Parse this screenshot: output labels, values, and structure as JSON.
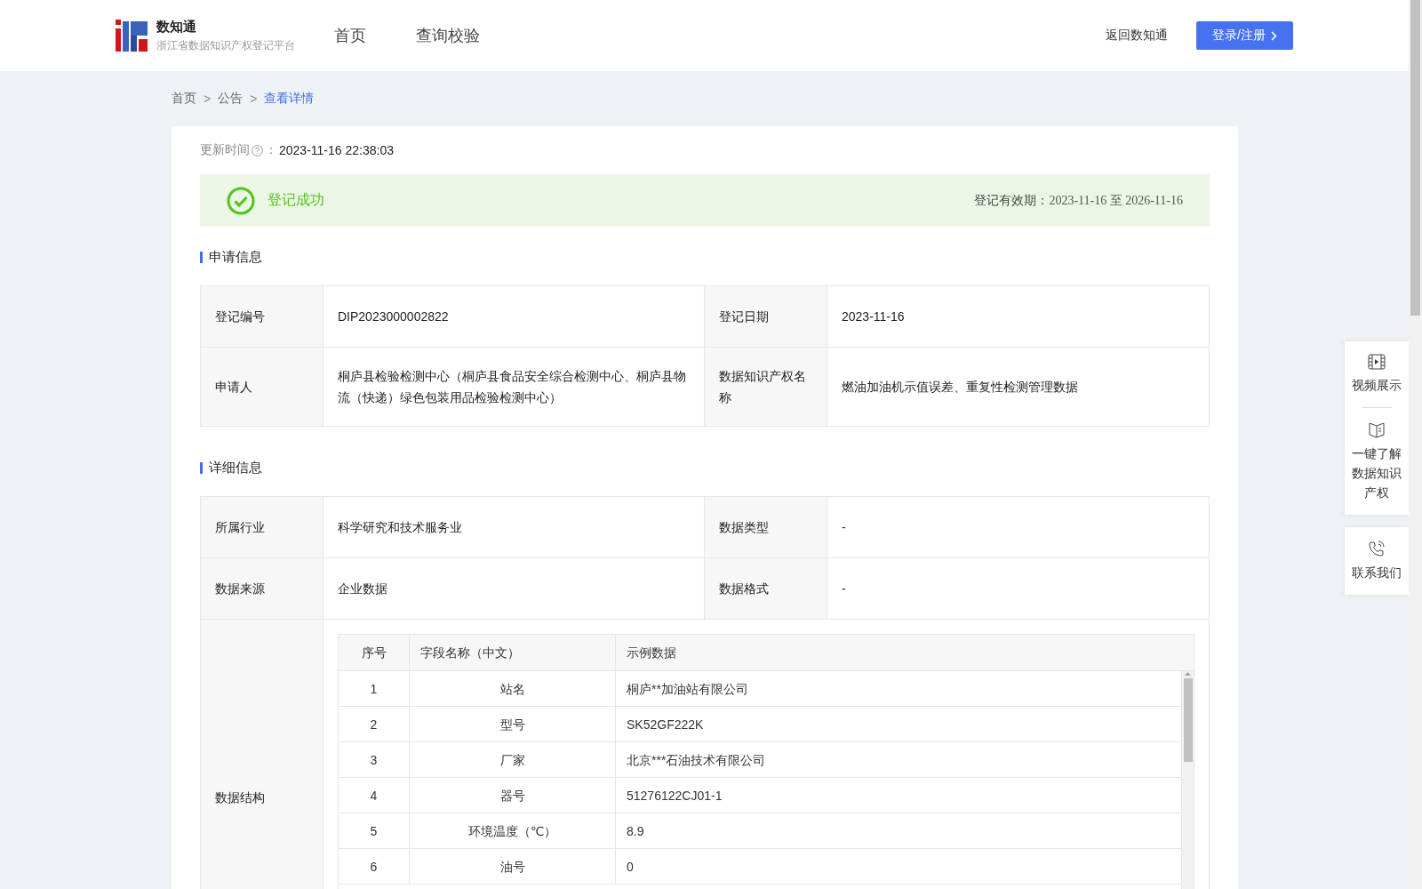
{
  "header": {
    "logo": {
      "title": "数知通",
      "subtitle": "浙江省数据知识产权登记平台"
    },
    "nav": [
      {
        "label": "首页"
      },
      {
        "label": "查询校验"
      }
    ],
    "back_link": "返回数知通",
    "login_button": "登录/注册"
  },
  "breadcrumb_separator": ">",
  "breadcrumb": [
    {
      "label": "首页",
      "current": false
    },
    {
      "label": "公告",
      "current": false
    },
    {
      "label": "查看详情",
      "current": true
    }
  ],
  "update": {
    "label": "更新时间",
    "colon": "：",
    "value": "2023-11-16 22:38:03"
  },
  "status": {
    "kind": "success",
    "text": "登记成功",
    "validity_label": "登记有效期：",
    "validity_value": "2023-11-16 至 2026-11-16"
  },
  "sections": [
    {
      "title": "申请信息",
      "rows": [
        [
          {
            "label": "登记编号",
            "value": "DIP2023000002822"
          },
          {
            "label": "登记日期",
            "value": "2023-11-16"
          }
        ],
        [
          {
            "label": "申请人",
            "value": "桐庐县检验检测中心（桐庐县食品安全综合检测中心、桐庐县物流（快递）绿色包装用品检验检测中心）"
          },
          {
            "label": "数据知识产权名称",
            "value": "燃油加油机示值误差、重复性检测管理数据"
          }
        ]
      ]
    },
    {
      "title": "详细信息",
      "rows": [
        [
          {
            "label": "所属行业",
            "value": "科学研究和技术服务业"
          },
          {
            "label": "数据类型",
            "value": "-"
          }
        ],
        [
          {
            "label": "数据来源",
            "value": "企业数据"
          },
          {
            "label": "数据格式",
            "value": "-"
          }
        ]
      ],
      "structure": {
        "label": "数据结构",
        "columns": [
          "序号",
          "字段名称（中文）",
          "示例数据"
        ],
        "rows": [
          [
            "1",
            "站名",
            "桐庐**加油站有限公司"
          ],
          [
            "2",
            "型号",
            "SK52GF222K"
          ],
          [
            "3",
            "厂家",
            "北京***石油技术有限公司"
          ],
          [
            "4",
            "器号",
            "51276122CJ01-1"
          ],
          [
            "5",
            "环境温度（℃）",
            "8.9"
          ],
          [
            "6",
            "油号",
            "0"
          ]
        ]
      }
    }
  ],
  "side_panel": [
    [
      {
        "kind": "video",
        "label": "视频展示"
      },
      {
        "kind": "book",
        "label": "一键了解数据知识产权"
      }
    ],
    [
      {
        "kind": "phone",
        "label": "联系我们"
      }
    ]
  ]
}
